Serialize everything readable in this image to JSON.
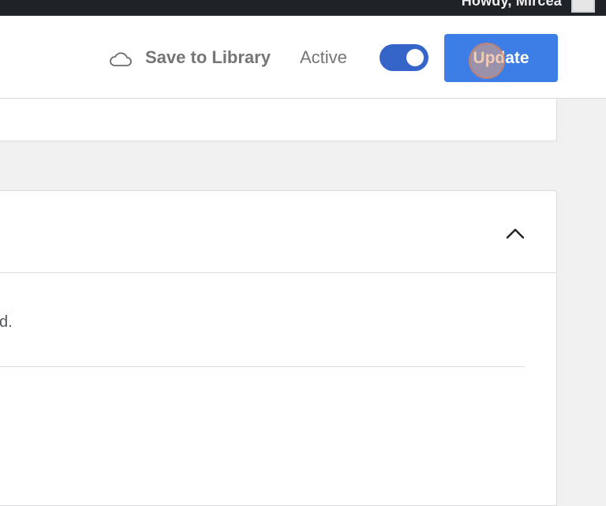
{
  "admin_bar": {
    "greeting": "Howdy, Mircea"
  },
  "header": {
    "save_to_library": "Save to Library",
    "status_label": "Active",
    "active_toggle_on": true,
    "update_button": "Update",
    "cloud_icon": "cloud-icon"
  },
  "panel": {
    "collapse_icon": "chevron-up-icon",
    "description_fragment": "d."
  },
  "colors": {
    "admin_bar": "#1d2327",
    "primary_button": "#3d7ee6",
    "toggle_on": "#3565c8",
    "background": "#f0f0f1"
  }
}
